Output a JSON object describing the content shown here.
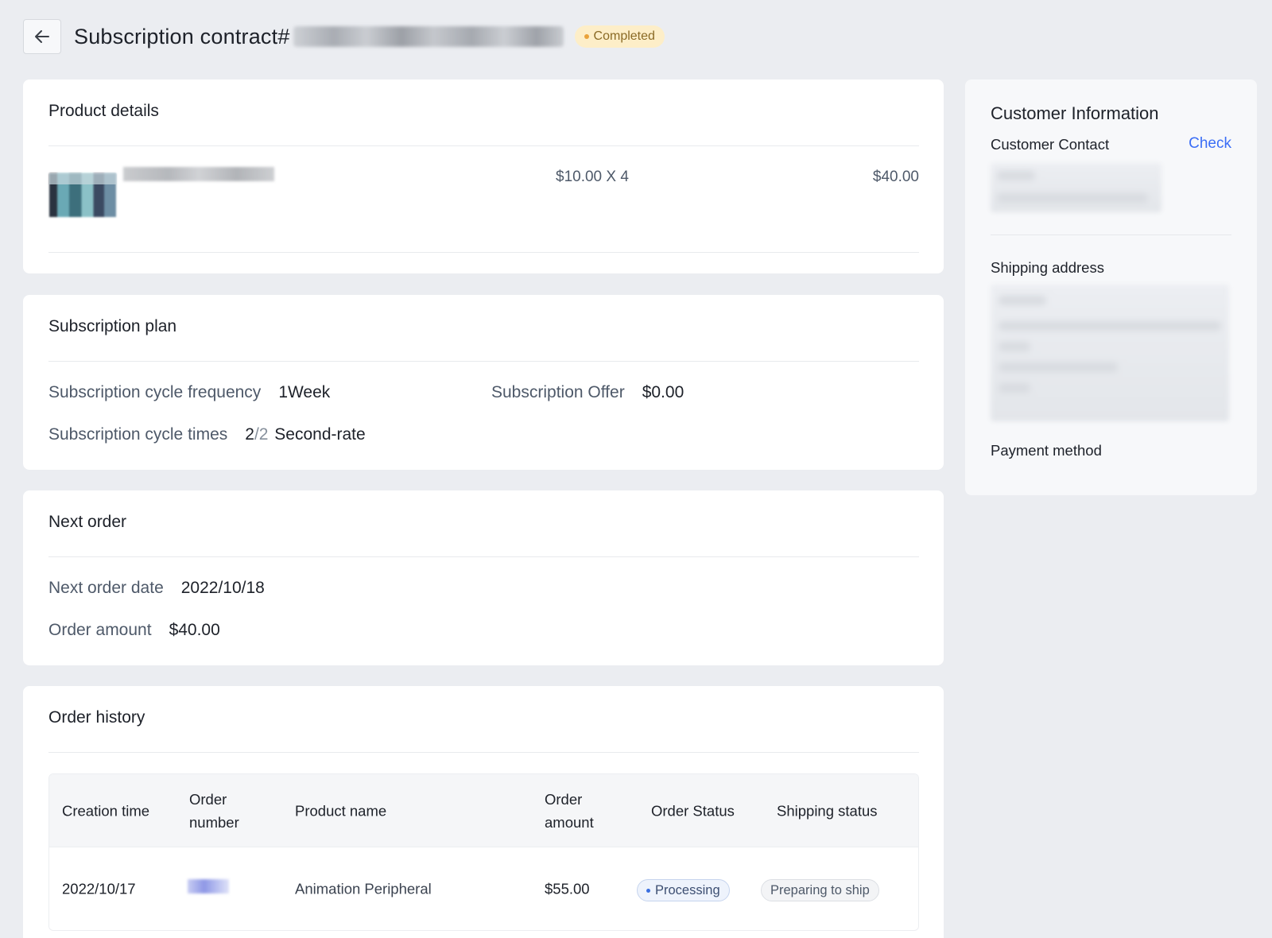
{
  "header": {
    "title": "Subscription contract#",
    "status": "Completed",
    "colors": {
      "status_bg": "#fdeec8",
      "status_dot": "#e9a23b"
    }
  },
  "product_details": {
    "title": "Product details",
    "items": [
      {
        "unit_price_qty": "$10.00 X 4",
        "total": "$40.00"
      }
    ]
  },
  "subscription_plan": {
    "title": "Subscription plan",
    "cycle_frequency_label": "Subscription cycle frequency",
    "cycle_frequency_value": "1Week",
    "offer_label": "Subscription Offer",
    "offer_value": "$0.00",
    "cycle_times_label": "Subscription cycle times",
    "cycle_times_current": "2",
    "cycle_times_total": "/2",
    "cycle_times_unit": "Second-rate"
  },
  "next_order": {
    "title": "Next order",
    "date_label": "Next order date",
    "date_value": "2022/10/18",
    "amount_label": "Order amount",
    "amount_value": "$40.00"
  },
  "order_history": {
    "title": "Order history",
    "columns": {
      "creation_time": "Creation time",
      "order_number_1": "Order",
      "order_number_2": "number",
      "product_name": "Product name",
      "order_amount_1": "Order",
      "order_amount_2": "amount",
      "order_status": "Order Status",
      "shipping_status": "Shipping status"
    },
    "rows": [
      {
        "creation_time": "2022/10/17",
        "product_name": "Animation Peripheral",
        "order_amount": "$55.00",
        "order_status": "Processing",
        "shipping_status": "Preparing to ship"
      }
    ]
  },
  "customer": {
    "title": "Customer Information",
    "contact_label": "Customer Contact",
    "check_link": "Check",
    "shipping_label": "Shipping address",
    "payment_label": "Payment method",
    "colors": {
      "link": "#3b6ef6"
    }
  },
  "icons": {
    "back": "arrow-left-icon"
  }
}
